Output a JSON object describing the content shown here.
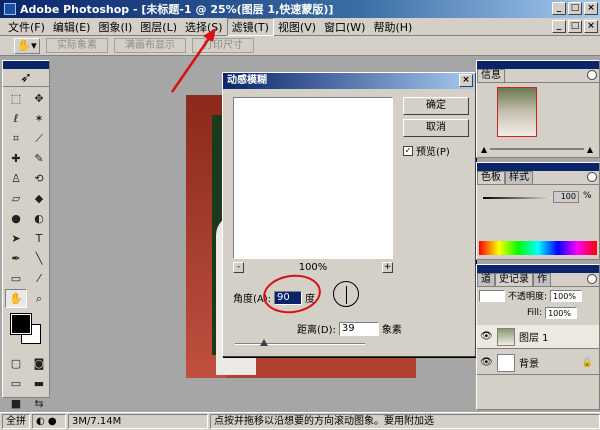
{
  "window": {
    "title": "Adobe Photoshop - [未标题-1 @ 25%(图层 1,快速蒙版)]"
  },
  "menubar": {
    "items": [
      "文件(F)",
      "编辑(E)",
      "图象(I)",
      "图层(L)",
      "选择(S)",
      "滤镜(T)",
      "视图(V)",
      "窗口(W)",
      "帮助(H)"
    ],
    "active_index": 5
  },
  "options": {
    "buttons": [
      "实际象素",
      "满画布显示",
      "打印尺寸"
    ]
  },
  "dialog": {
    "title": "动感模糊",
    "ok": "确定",
    "cancel": "取消",
    "preview_label": "预览(P)",
    "preview_checked": "✓",
    "zoom": "100%",
    "zoom_minus": "-",
    "zoom_plus": "+",
    "angle_label": "角度(A):",
    "angle_value": "90",
    "angle_unit": "度",
    "distance_label": "距离(D):",
    "distance_value": "39",
    "distance_unit": "象素"
  },
  "panels": {
    "navigator": {
      "tab": "信息"
    },
    "color": {
      "tabs": [
        "色板",
        "样式"
      ],
      "value": "100",
      "unit": "%"
    },
    "layers": {
      "tabs": [
        "道",
        "史记录",
        "作"
      ],
      "opacity_label": "不透明度:",
      "opacity_value": "100%",
      "fill_label": "Fill:",
      "fill_value": "100%",
      "rows": [
        {
          "name": "图层 1",
          "active": true
        },
        {
          "name": "背景",
          "active": false
        }
      ]
    }
  },
  "statusbar": {
    "zoom": "全拼",
    "doc_size": "3M/7.14M",
    "hint": "点按并拖移以沿想要的方向滚动图象。要用附加选"
  },
  "colors": {
    "title_blue": "#0a246a",
    "face": "#d4d0c8",
    "annotation_red": "#d81010"
  }
}
